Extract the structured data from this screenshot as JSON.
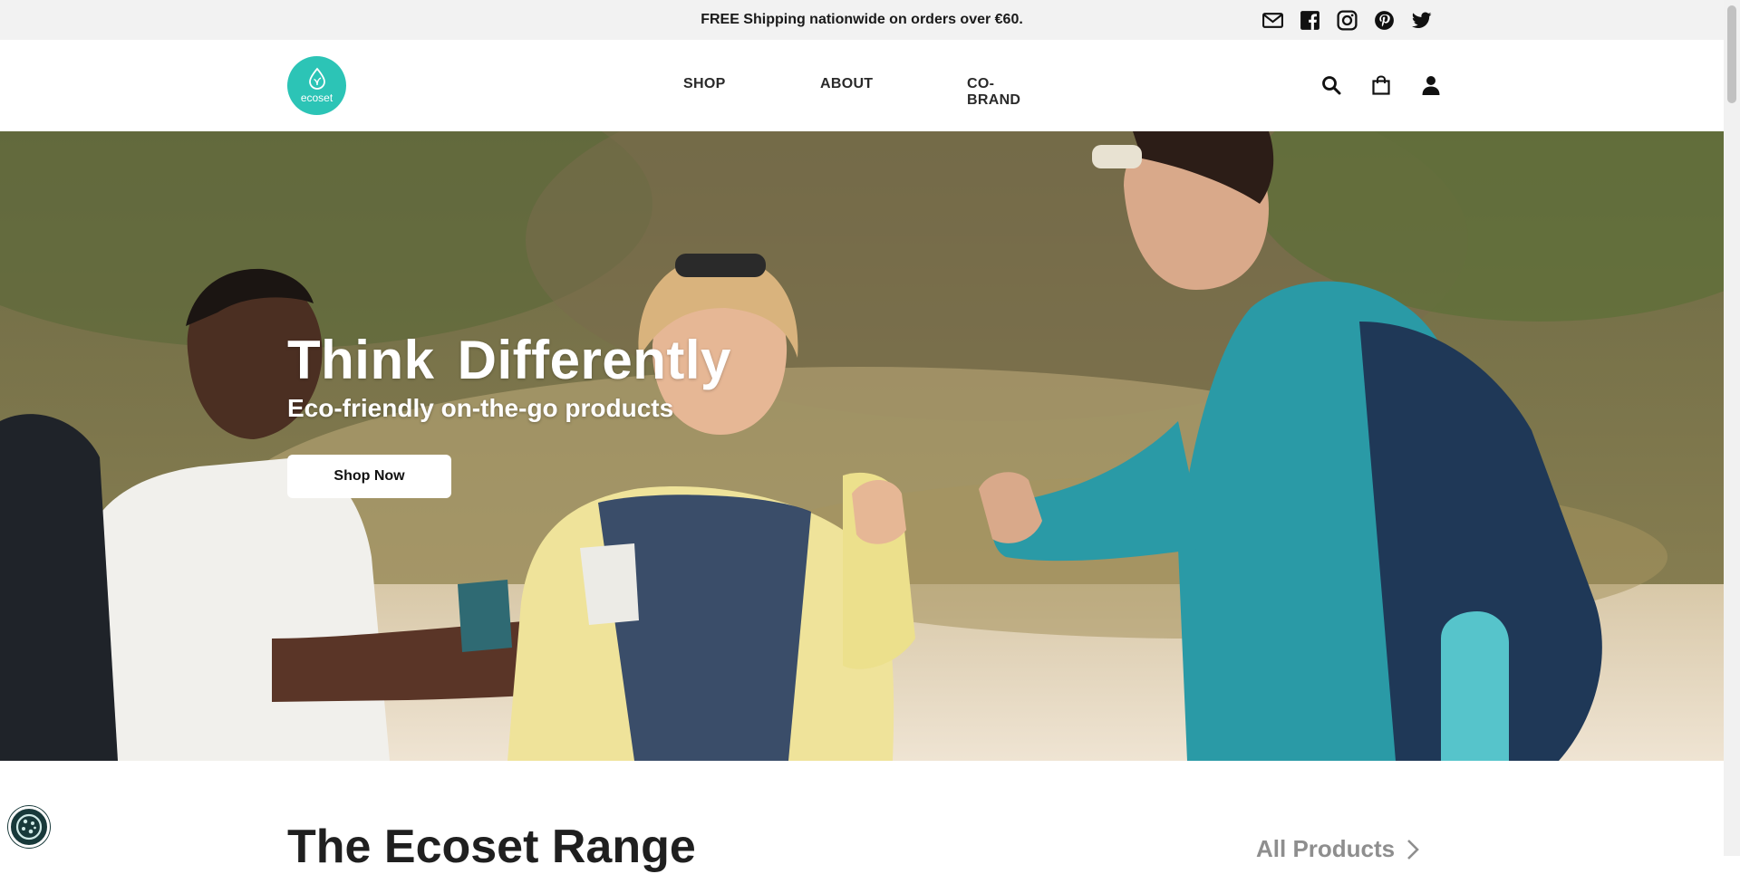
{
  "announcement": {
    "text": "FREE Shipping nationwide on orders over €60."
  },
  "social_icons": [
    "mail-icon",
    "facebook-icon",
    "instagram-icon",
    "pinterest-icon",
    "twitter-icon"
  ],
  "brand": {
    "logo_text": "ecoset",
    "color": "#2cc4b6"
  },
  "nav": {
    "shop": "SHOP",
    "about": "ABOUT",
    "cobrand": "CO-BRAND"
  },
  "header_icons": [
    "search-icon",
    "shopping-bag-icon",
    "user-icon"
  ],
  "hero": {
    "title": "Think Differently",
    "subtitle": "Eco-friendly on-the-go products",
    "button": "Shop Now"
  },
  "range": {
    "title": "The Ecoset Range",
    "link": "All Products"
  },
  "cookie_icon": "cookie-icon"
}
